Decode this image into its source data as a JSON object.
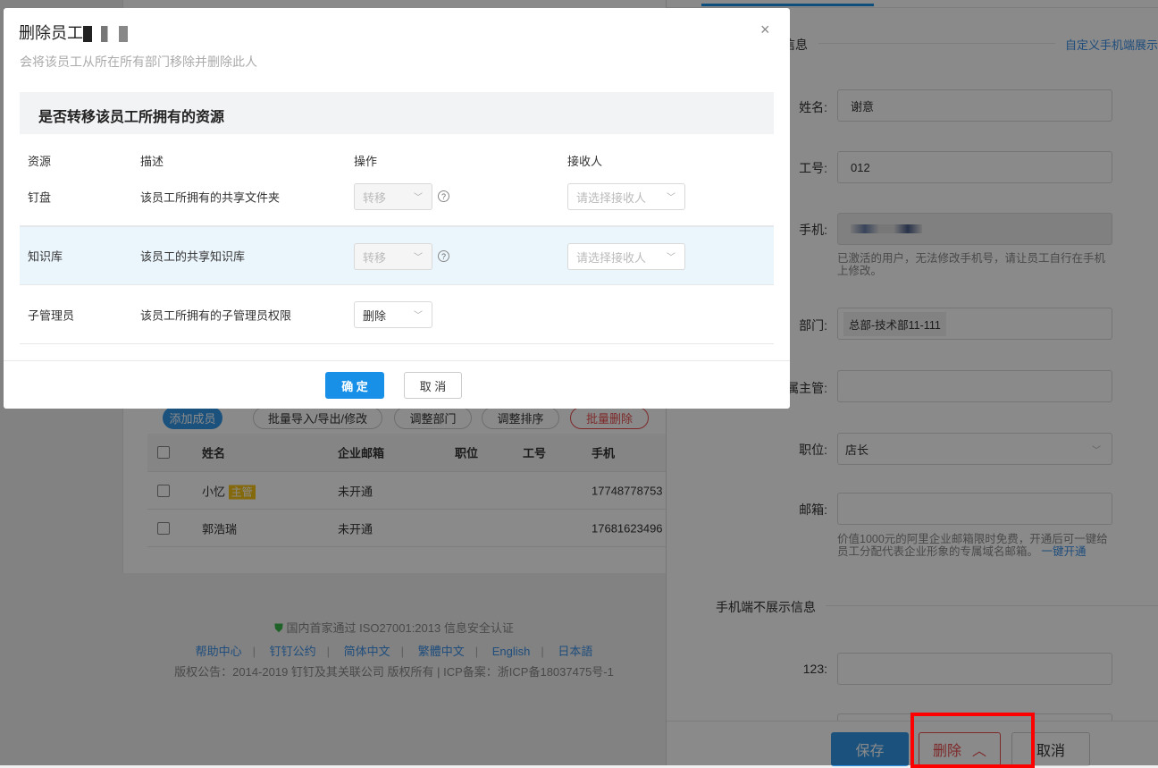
{
  "page": {
    "toolbar": [
      "添加成员",
      "批量导入/导出/修改",
      "调整部门",
      "调整排序",
      "批量删除"
    ],
    "table_headers": [
      "姓名",
      "企业邮箱",
      "职位",
      "工号",
      "手机"
    ],
    "rows": [
      {
        "name": "小忆",
        "badge": "主管",
        "email": "未开通",
        "phone": "17748778753"
      },
      {
        "name": "郭浩瑞",
        "badge": "",
        "email": "未开通",
        "phone": "17681623496"
      }
    ],
    "footer": {
      "cert": "国内首家通过 ISO27001:2013 信息安全认证",
      "links": [
        "帮助中心",
        "钉钉公约",
        "简体中文",
        "繁體中文",
        "English",
        "日本語"
      ],
      "copyright": "版权公告：2014-2019 钉钉及其关联公司 版权所有 | ICP备案：浙ICP备18037475号-1"
    }
  },
  "drawer": {
    "section1": "信息",
    "custom_link": "自定义手机端展示",
    "fields": {
      "name_label": "姓名:",
      "name": "谢意",
      "id_label": "工号:",
      "id": "012",
      "phone_label": "手机:",
      "phone_hint": "已激活的用户，无法修改手机号，请让员工自行在手机上修改。",
      "dept_label": "部门:",
      "dept": "总部-技术部11-111",
      "manager_label": "直属主管:",
      "position_label": "职位:",
      "position": "店长",
      "email_label": "邮箱:",
      "email_hint": "价值1000元的阿里企业邮箱限时免费，开通后可一键给员工分配代表企业形象的专属域名邮箱。",
      "email_link": "一键开通",
      "section2": "手机端不展示信息",
      "custom_label": "123:"
    },
    "buttons": {
      "save": "保存",
      "delete": "删除",
      "cancel": "取消"
    }
  },
  "modal": {
    "title": "删除员工",
    "subtitle": "会将该员工从所在所有部门移除并删除此人",
    "section_title": "是否转移该员工所拥有的资源",
    "headers": [
      "资源",
      "描述",
      "操作",
      "接收人"
    ],
    "rows": [
      {
        "resource": "钉盘",
        "desc": "该员工所拥有的共享文件夹",
        "action": "转移",
        "receiver_placeholder": "请选择接收人"
      },
      {
        "resource": "知识库",
        "desc": "该员工的共享知识库",
        "action": "转移",
        "receiver_placeholder": "请选择接收人"
      },
      {
        "resource": "子管理员",
        "desc": "该员工所拥有的子管理员权限",
        "action": "删除"
      }
    ],
    "ok": "确 定",
    "cancel": "取 消"
  },
  "colors": {
    "primary": "#1890e8",
    "danger": "#e84c4c",
    "highlight": "#ff0000",
    "badge": "#f5c518"
  }
}
